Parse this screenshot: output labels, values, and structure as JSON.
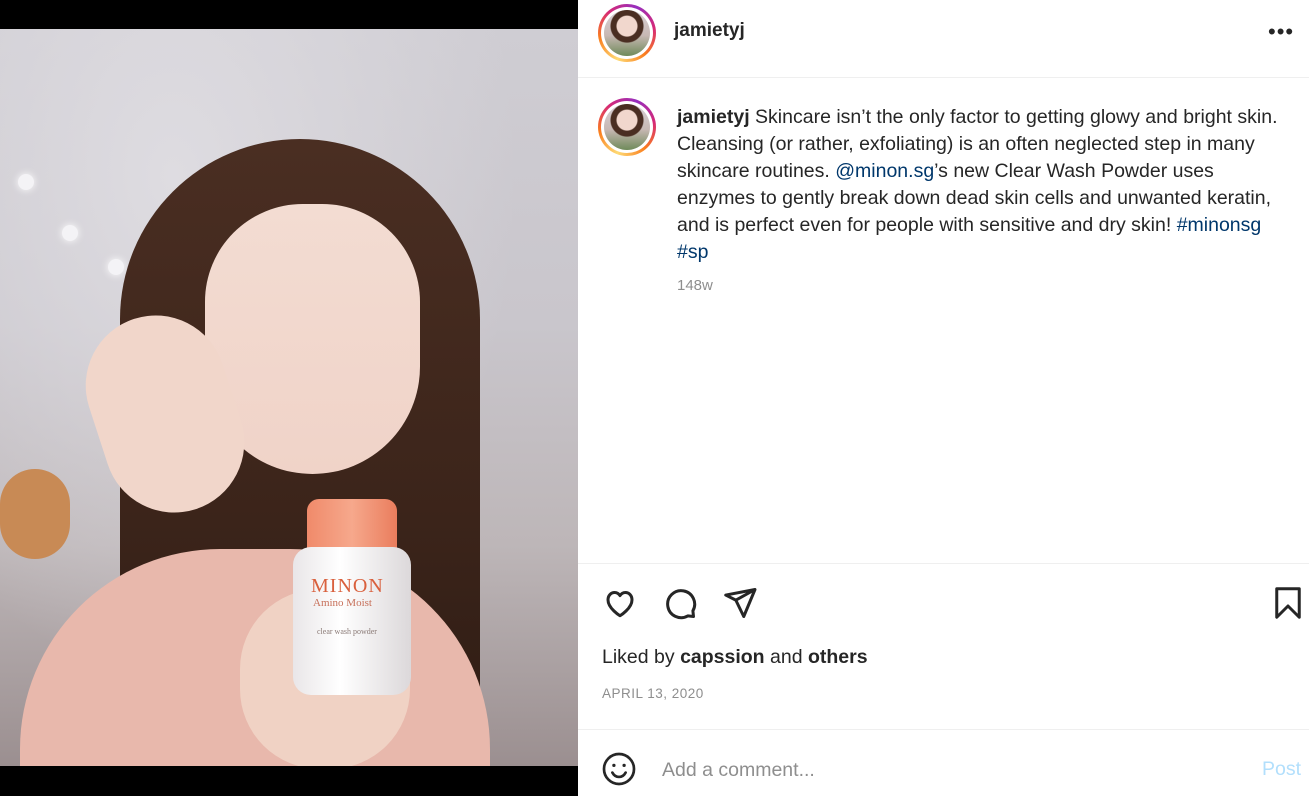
{
  "post": {
    "username": "jamietyj",
    "caption_user": "jamietyj",
    "caption_text_1": " Skincare isn’t the only factor to getting glowy and bright skin. Cleansing (or rather, exfoliating) is an often neglected step in many skincare routines. ",
    "mention": "@minon.sg",
    "caption_text_2": "’s new Clear Wash Powder uses enzymes to gently break down dead skin cells and unwanted keratin, and is perfect even for people with sensitive and dry skin! ",
    "hashtag_1": "#minonsg",
    "hashtag_2": "#sp",
    "time_ago": "148w",
    "liked_by_prefix": "Liked by ",
    "liked_by_user": "capssion",
    "liked_by_and": " and ",
    "liked_by_others": "others",
    "date": "APRIL 13, 2020"
  },
  "photo": {
    "brand": "MINON",
    "sub": "Amino Moist",
    "small": "clear wash powder"
  },
  "header": {
    "more_label": "•••"
  },
  "comment": {
    "placeholder": "Add a comment...",
    "post_label": "Post"
  },
  "icons": {
    "like": "heart-icon",
    "comment": "comment-icon",
    "share": "share-icon",
    "save": "bookmark-icon",
    "emoji": "emoji-icon",
    "more": "more-options-icon"
  }
}
